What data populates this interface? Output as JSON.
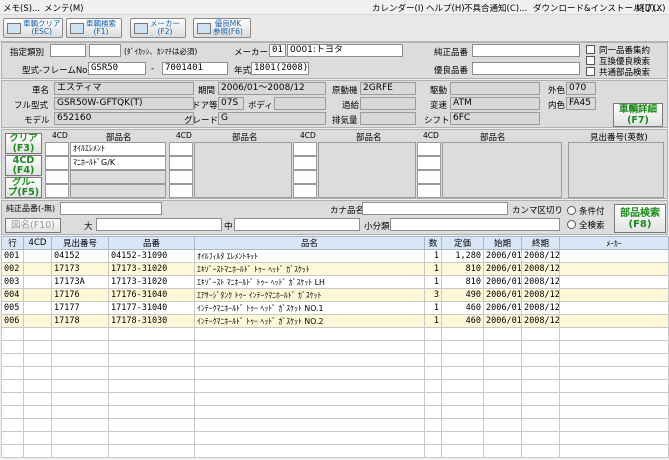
{
  "menu": {
    "left": [
      "メモ(S)...",
      "メンテ(M)"
    ],
    "right": [
      "カレンダー(I)",
      "ヘルプ(H)",
      "不具合通知(C)...",
      "ダウンロード&インストール(D)...",
      "終了(X)"
    ]
  },
  "toolbar": {
    "buttons": [
      {
        "line1": "車輌クリア",
        "line2": "(ESC)"
      },
      {
        "line1": "車輌検索",
        "line2": "(F1)"
      },
      {
        "line1": "メーカー",
        "line2": "(F2)"
      },
      {
        "line1": "優良MK",
        "line2": "参照(F6)"
      }
    ]
  },
  "search": {
    "label_type": "指定類別",
    "type_value1": "",
    "type_value2": "",
    "hint": "(ﾀﾞｲｶｯｼ、ｶﾝﾏﾁは必須)",
    "label_maker": "メーカー",
    "maker_code": "01",
    "maker_name": "0001:トヨタ",
    "label_frame": "型式-フレームNo.",
    "model_code": "GSR50",
    "dash": "-",
    "frame_no": "7001401",
    "label_year": "年式",
    "year_value": "1801(2008)",
    "label_genuine_no": "純正品番",
    "genuine_no_value": "",
    "label_premium_no": "優良品番",
    "premium_no_value": "",
    "chk_same": "同一品番集約",
    "chk_compat": "互換優良検索",
    "chk_common": "共通部品検索"
  },
  "vehicle": {
    "label_name": "車名",
    "name": "エスティマ",
    "label_period": "期間",
    "period": "2006/01～2008/12",
    "label_engine": "原動機",
    "engine": "2GRFE",
    "label_drive": "駆動",
    "drive": "",
    "label_ext_color": "外色",
    "ext_color": "070",
    "label_full_model": "フル型式",
    "full_model": "GSR50W-GFTQK(T)",
    "label_door": "ドア等",
    "door": "07S",
    "label_body": "ボディ",
    "body": "",
    "label_turbo": "過給",
    "turbo": "",
    "label_trans": "変速",
    "trans": "ATM",
    "label_int_color": "内色",
    "int_color": "FA45",
    "label_model": "モデル",
    "model": "652160",
    "label_grade": "グレード",
    "grade": "G",
    "label_displacement": "排気量",
    "displacement": "",
    "label_shift": "シフト",
    "shift": "6FC",
    "detail_btn_line1": "車輌詳細",
    "detail_btn_line2": "(F7)"
  },
  "parts_entry": {
    "header_4cd": "4CD",
    "header_name": "部品名",
    "header_num": "見出番号(英数)",
    "btn_clear": [
      "クリア",
      "(F3)"
    ],
    "btn_4cd": [
      "4CD",
      "(F4)"
    ],
    "btn_group": [
      "グル-",
      "プ(F5)"
    ],
    "col1": [
      {
        "code": "",
        "name": "ｵｲﾙｴﾚﾒﾝﾄ"
      },
      {
        "code": "",
        "name": "ﾏﾆﾎｰﾙﾄﾞG/K"
      },
      {
        "code": "",
        "name": ""
      },
      {
        "code": "",
        "name": ""
      }
    ]
  },
  "filters": {
    "label_genuine": "純正品番(-無)",
    "genuine": "",
    "label_kana": "カナ品名",
    "kana": "",
    "label_comma": "カンマ区切り",
    "radio_cond": "条件付",
    "radio_all": "全検索",
    "btn_figure": "図名(F10)",
    "label_large": "大",
    "label_mid": "中",
    "label_small": "小分類",
    "parts_search_line1": "部品検索",
    "parts_search_line2": "(F8)"
  },
  "results": {
    "headers": [
      "行",
      "4CD",
      "見出番号",
      "品番",
      "品名",
      "数",
      "定価",
      "始期",
      "終期",
      "ﾒｰｶｰ"
    ],
    "rows": [
      {
        "row": "001",
        "cd": "",
        "num": "04152",
        "part": "04152-31090",
        "name": "ｵｲﾙﾌｨﾙﾀ ｴﾚﾒﾝﾄｷｯﾄ",
        "qty": "1",
        "price": "1,280",
        "start": "2006/01",
        "end": "2008/12",
        "maker": ""
      },
      {
        "row": "002",
        "cd": "",
        "num": "17173",
        "part": "17173-31020",
        "name": "ｴｷｿﾞｰｽﾄﾏﾆﾎｰﾙﾄﾞ ﾄｩｰ ﾍｯﾄﾞ ｶﾞｽｹｯﾄ",
        "qty": "1",
        "price": "810",
        "start": "2006/01",
        "end": "2008/12",
        "maker": ""
      },
      {
        "row": "003",
        "cd": "",
        "num": "17173A",
        "part": "17173-31020",
        "name": "ｴｷｿﾞｰｽﾄ ﾏﾆﾎｰﾙﾄﾞ ﾄｩｰ ﾍｯﾄﾞ ｶﾞｽｹｯﾄ LH",
        "qty": "1",
        "price": "810",
        "start": "2006/01",
        "end": "2008/12",
        "maker": ""
      },
      {
        "row": "004",
        "cd": "",
        "num": "17176",
        "part": "17176-31040",
        "name": "ｴｱｻｰｼﾞﾀﾝｸ ﾄｩｰ ｲﾝﾃｰｸﾏﾆﾎｰﾙﾄﾞ ｶﾞｽｹｯﾄ",
        "qty": "3",
        "price": "490",
        "start": "2006/01",
        "end": "2008/12",
        "maker": ""
      },
      {
        "row": "005",
        "cd": "",
        "num": "17177",
        "part": "17177-31040",
        "name": "ｲﾝﾃｰｸﾏﾆﾎｰﾙﾄﾞ ﾄｩｰ ﾍｯﾄﾞ ｶﾞｽｹｯﾄ NO.1",
        "qty": "1",
        "price": "460",
        "start": "2006/01",
        "end": "2008/12",
        "maker": ""
      },
      {
        "row": "006",
        "cd": "",
        "num": "17178",
        "part": "17178-31030",
        "name": "ｲﾝﾃｰｸﾏﾆﾎｰﾙﾄﾞ ﾄｩｰ ﾍｯﾄﾞ ｶﾞｽｹｯﾄ NO.2",
        "qty": "1",
        "price": "460",
        "start": "2006/01",
        "end": "2008/12",
        "maker": ""
      }
    ]
  }
}
